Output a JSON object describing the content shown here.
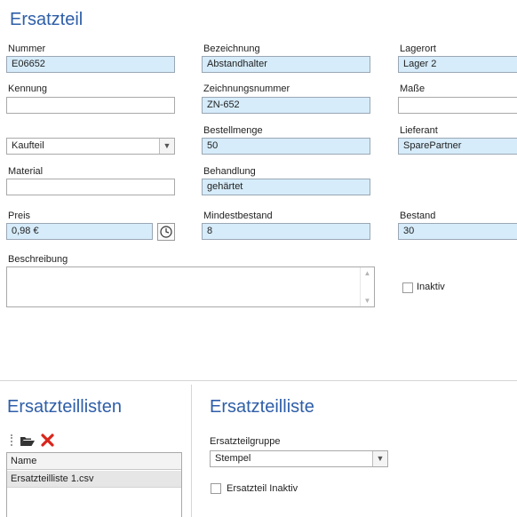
{
  "form": {
    "title": "Ersatzteil",
    "nummer": {
      "label": "Nummer",
      "value": "E06652"
    },
    "bezeichnung": {
      "label": "Bezeichnung",
      "value": "Abstandhalter"
    },
    "lagerort": {
      "label": "Lagerort",
      "value": "Lager 2"
    },
    "kennung": {
      "label": "Kennung",
      "value": ""
    },
    "zeichnungsnummer": {
      "label": "Zeichnungsnummer",
      "value": "ZN-652"
    },
    "masse": {
      "label": "Maße",
      "value": ""
    },
    "typ": {
      "value": "Kaufteil"
    },
    "bestellmenge": {
      "label": "Bestellmenge",
      "value": "50"
    },
    "lieferant": {
      "label": "Lieferant",
      "value": "SparePartner"
    },
    "material": {
      "label": "Material",
      "value": ""
    },
    "behandlung": {
      "label": "Behandlung",
      "value": "gehärtet"
    },
    "preis": {
      "label": "Preis",
      "value": "0,98 €"
    },
    "mindestbestand": {
      "label": "Mindestbestand",
      "value": "8"
    },
    "bestand": {
      "label": "Bestand",
      "value": "30"
    },
    "beschreibung": {
      "label": "Beschreibung",
      "value": ""
    },
    "inaktiv": {
      "label": "Inaktiv",
      "checked": false
    }
  },
  "lists_panel": {
    "title": "Ersatzteillisten",
    "column_name": "Name",
    "rows": [
      "Ersatzteilliste 1.csv"
    ]
  },
  "list_panel": {
    "title": "Ersatzteilliste",
    "gruppe_label": "Ersatzteilgruppe",
    "gruppe_value": "Stempel",
    "inaktiv_label": "Ersatzteil Inaktiv",
    "inaktiv_checked": false
  },
  "colors": {
    "accent": "#2e5ea8",
    "required_field": "#d6ecfa",
    "delete_icon": "#d9261c",
    "folder_icon": "#333333"
  }
}
